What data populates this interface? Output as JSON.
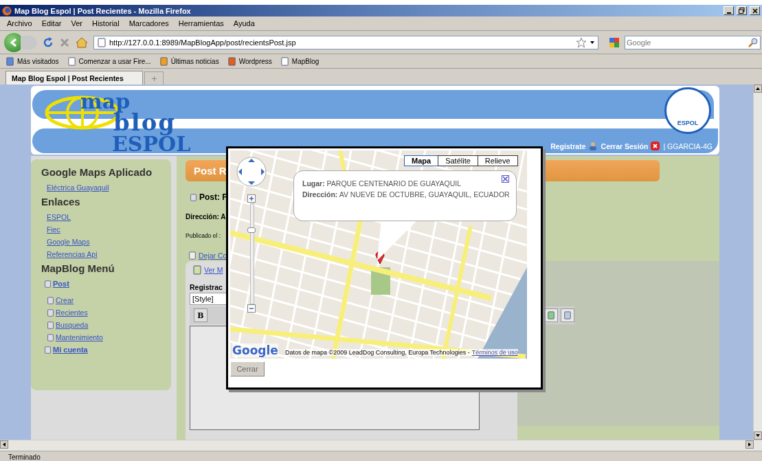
{
  "window": {
    "title": "Map Blog Espol | Post Recientes - Mozilla Firefox"
  },
  "menu": [
    "Archivo",
    "Editar",
    "Ver",
    "Historial",
    "Marcadores",
    "Herramientas",
    "Ayuda"
  ],
  "address": {
    "value": "http://127.0.0.1:8989/MapBlogApp/post/recientsPost.jsp"
  },
  "search": {
    "placeholder": "Google"
  },
  "bookmarks": [
    "Más visitados",
    "Comenzar a usar Fire...",
    "Últimas noticias",
    "Wordpress",
    "MapBlog"
  ],
  "tabs": [
    {
      "label": "Map Blog Espol | Post Recientes",
      "selected": true
    }
  ],
  "site": {
    "logo": [
      "map",
      "blog",
      "ESPOL"
    ],
    "seal_text": "ESPOL",
    "nav": [
      "Registrate",
      "Cerrar Sesión"
    ],
    "user": "| GGARCIA-4G"
  },
  "sidebar": {
    "sections": [
      {
        "title": "Google Maps Aplicado",
        "items": [
          {
            "label": "Eléctrica Guayaquil",
            "kind": "plain"
          }
        ]
      },
      {
        "title": "Enlaces",
        "items": [
          {
            "label": "ESPOL",
            "kind": "plain"
          },
          {
            "label": "Fiec",
            "kind": "plain"
          },
          {
            "label": "Google Maps",
            "kind": "plain"
          },
          {
            "label": "Referencias Api",
            "kind": "plain"
          }
        ]
      },
      {
        "title": "MapBlog Menú",
        "items": [
          {
            "label": "Post",
            "kind": "section"
          },
          {
            "label": "Crear",
            "kind": "sub"
          },
          {
            "label": "Recientes",
            "kind": "sub"
          },
          {
            "label": "Busqueda",
            "kind": "sub"
          },
          {
            "label": "Mantenimiento",
            "kind": "sub"
          },
          {
            "label": "Mi cuenta",
            "kind": "section"
          }
        ]
      }
    ]
  },
  "main": {
    "heading": "Post R",
    "post_title": "Post: F",
    "address_line": "Dirección: A",
    "published": "Publicado el :",
    "links": [
      "Dejar Co",
      "Ver M"
    ],
    "editor": {
      "label": "Registrac",
      "style": "[Style]",
      "bold_button": "B"
    }
  },
  "map_dialog": {
    "map_types": [
      {
        "label": "Mapa",
        "selected": true
      },
      {
        "label": "Satélite",
        "selected": false
      },
      {
        "label": "Relieve",
        "selected": false
      }
    ],
    "info": [
      {
        "label": "Lugar:",
        "value": "PARQUE CENTENARIO DE GUAYAQUIL"
      },
      {
        "label": "Dirección:",
        "value": "AV NUEVE DE OCTUBRE, GUAYAQUIL, ECUADOR"
      }
    ],
    "zoom": {
      "level": 0.75
    },
    "google_logo": "Google",
    "attribution": "Datos de mapa ©2009 LeadDog Consulting, Europa Technologies -",
    "terms": "Términos de uso",
    "close_button": "Cerrar"
  },
  "status_bar": "Terminado"
}
